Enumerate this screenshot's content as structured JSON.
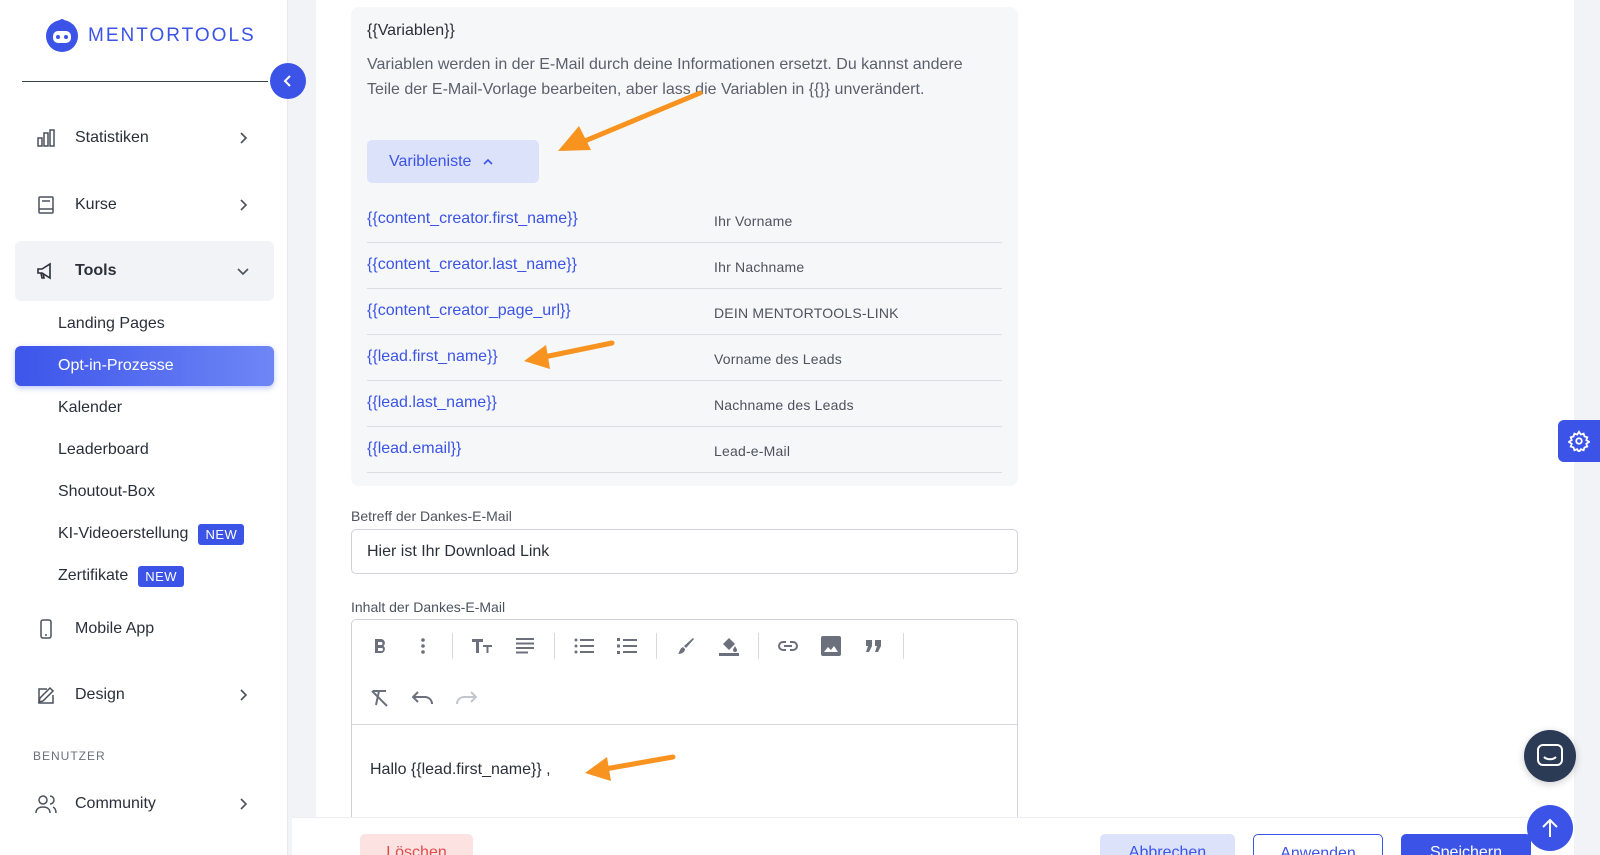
{
  "brand": {
    "name": "MENTORTOOLS",
    "color": "#3b53e6"
  },
  "sidebar": {
    "items": [
      {
        "label": "Statistiken",
        "icon": "bar-chart-icon"
      },
      {
        "label": "Kurse",
        "icon": "book-icon"
      },
      {
        "label": "Tools",
        "icon": "megaphone-icon"
      },
      {
        "label": "Mobile App",
        "icon": "smartphone-icon"
      },
      {
        "label": "Design",
        "icon": "pencil-icon"
      },
      {
        "label": "Community",
        "icon": "users-icon"
      }
    ],
    "tools_sub": [
      {
        "label": "Landing Pages"
      },
      {
        "label": "Opt-in-Prozesse"
      },
      {
        "label": "Kalender"
      },
      {
        "label": "Leaderboard"
      },
      {
        "label": "Shoutout-Box"
      },
      {
        "label": "KI-Videoerstellung",
        "badge": "NEW"
      },
      {
        "label": "Zertifikate",
        "badge": "NEW"
      }
    ],
    "section_label": "BENUTZER"
  },
  "variables": {
    "title": "{{Variablen}}",
    "description": "Variablen werden in der E-Mail durch deine Informationen ersetzt. Du kannst andere Teile der E-Mail-Vorlage bearbeiten, aber lass die Variablen in {{}} unverändert.",
    "toggle_label": "Varibleniste",
    "rows": [
      {
        "code": "{{content_creator.first_name}}",
        "desc": "Ihr Vorname"
      },
      {
        "code": "{{content_creator.last_name}}",
        "desc": "Ihr Nachname"
      },
      {
        "code": "{{content_creator_page_url}}",
        "desc": "DEIN MENTORTOOLS-LINK"
      },
      {
        "code": "{{lead.first_name}}",
        "desc": "Vorname des Leads"
      },
      {
        "code": "{{lead.last_name}}",
        "desc": "Nachname des Leads"
      },
      {
        "code": "{{lead.email}}",
        "desc": "Lead-e-Mail"
      }
    ]
  },
  "subject": {
    "label": "Betreff der Dankes-E-Mail",
    "value": "Hier ist Ihr Download Link"
  },
  "content": {
    "label": "Inhalt der Dankes-E-Mail",
    "body": "Hallo {{lead.first_name}} ,"
  },
  "footer": {
    "delete_label": "Löschen",
    "cancel_label": "Abbrechen",
    "apply_label": "Anwenden",
    "save_label": "Speichern"
  },
  "annotation_color": "#f7931e"
}
